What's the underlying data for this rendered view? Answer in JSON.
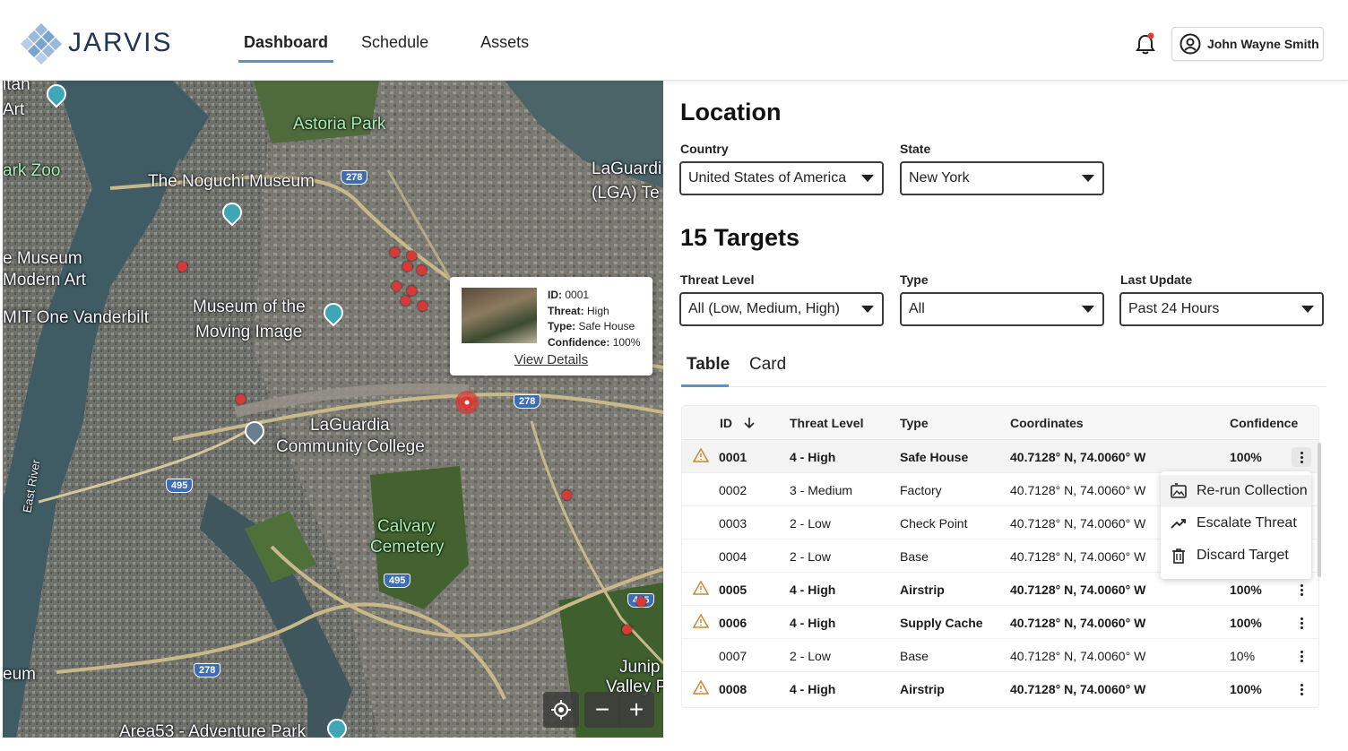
{
  "app": {
    "name": "JARVIS"
  },
  "nav": {
    "items": [
      {
        "label": "Dashboard",
        "active": true
      },
      {
        "label": "Schedule",
        "active": false
      },
      {
        "label": "Assets",
        "active": false
      }
    ]
  },
  "user": {
    "name": "John Wayne Smith"
  },
  "map": {
    "labels": [
      "itan",
      "Art",
      "Astoria Park",
      "ark Zoo",
      "The Noguchi Museum",
      "LaGuardi",
      "(LGA) Te",
      "e Museum",
      "Modern Art",
      "MIT One Vanderbilt",
      "Museum of the",
      "Moving Image",
      "LaGuardia",
      "Community College",
      "East River",
      "Calvary",
      "Cemetery",
      "eum",
      "Junip",
      "Valley P",
      "Area53 - Adventure Park"
    ],
    "shields": [
      "278",
      "278",
      "495",
      "495",
      "495",
      "278"
    ],
    "popup": {
      "id_label": "ID:",
      "id": "0001",
      "threat_label": "Threat:",
      "threat": "High",
      "type_label": "Type:",
      "type": "Safe House",
      "confidence_label": "Confidence:",
      "confidence": "100%",
      "link": "View Details"
    },
    "controls": {
      "locate": "locate-icon",
      "zoom_out": "−",
      "zoom_in": "+"
    }
  },
  "location": {
    "title": "Location",
    "country": {
      "label": "Country",
      "value": "United States of America"
    },
    "state": {
      "label": "State",
      "value": "New York"
    }
  },
  "targets": {
    "title": "15 Targets",
    "threat_level": {
      "label": "Threat Level",
      "value": "All (Low, Medium, High)"
    },
    "type": {
      "label": "Type",
      "value": "All"
    },
    "last_update": {
      "label": "Last Update",
      "value": "Past 24 Hours"
    },
    "tabs": [
      {
        "label": "Table",
        "active": true
      },
      {
        "label": "Card",
        "active": false
      }
    ],
    "columns": {
      "id": "ID",
      "threat": "Threat Level",
      "type": "Type",
      "coords": "Coordinates",
      "confidence": "Confidence"
    },
    "rows": [
      {
        "id": "0001",
        "threat": "4 - High",
        "type": "Safe House",
        "coords": "40.7128° N, 74.0060° W",
        "confidence": "100%",
        "high": true
      },
      {
        "id": "0002",
        "threat": "3 - Medium",
        "type": "Factory",
        "coords": "40.7128° N, 74.0060° W",
        "confidence": "",
        "high": false
      },
      {
        "id": "0003",
        "threat": "2 - Low",
        "type": "Check Point",
        "coords": "40.7128° N, 74.0060° W",
        "confidence": "",
        "high": false
      },
      {
        "id": "0004",
        "threat": "2 - Low",
        "type": "Base",
        "coords": "40.7128° N, 74.0060° W",
        "confidence": "",
        "high": false
      },
      {
        "id": "0005",
        "threat": "4 - High",
        "type": "Airstrip",
        "coords": "40.7128° N, 74.0060° W",
        "confidence": "100%",
        "high": true
      },
      {
        "id": "0006",
        "threat": "4 - High",
        "type": "Supply Cache",
        "coords": "40.7128° N, 74.0060° W",
        "confidence": "100%",
        "high": true
      },
      {
        "id": "0007",
        "threat": "2 - Low",
        "type": "Base",
        "coords": "40.7128° N, 74.0060° W",
        "confidence": "10%",
        "high": false
      },
      {
        "id": "0008",
        "threat": "4 - High",
        "type": "Airstrip",
        "coords": "40.7128° N, 74.0060° W",
        "confidence": "100%",
        "high": true
      }
    ],
    "row_menu": [
      {
        "label": "Re-run Collection",
        "icon": "rerun-image-icon"
      },
      {
        "label": "Escalate Threat",
        "icon": "trending-up-icon"
      },
      {
        "label": "Discard Target",
        "icon": "trash-icon"
      }
    ]
  },
  "colors": {
    "accent": "#5a92c5",
    "threat_marker": "#d83a3a",
    "brand": "#1e3554"
  }
}
